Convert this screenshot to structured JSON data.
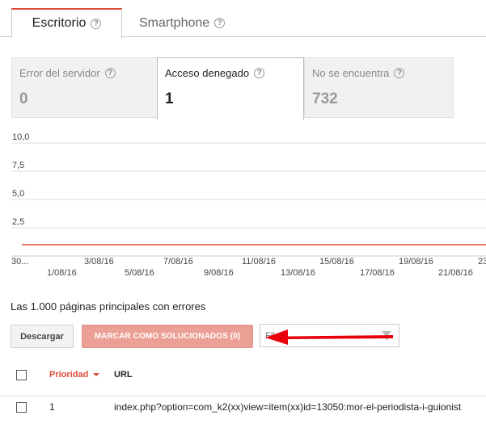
{
  "device_tabs": [
    {
      "label": "Escritorio",
      "active": true
    },
    {
      "label": "Smartphone",
      "active": false
    }
  ],
  "help_glyph": "?",
  "categories": [
    {
      "label": "Error del servidor",
      "count": "0",
      "selected": false
    },
    {
      "label": "Acceso denegado",
      "count": "1",
      "selected": true
    },
    {
      "label": "No se encuentra",
      "count": "732",
      "selected": false
    }
  ],
  "chart_data": {
    "type": "line",
    "y_ticks": [
      "10,0",
      "7,5",
      "5,0",
      "2,5"
    ],
    "ylim": [
      0,
      10
    ],
    "x_ticks_top": [
      "30...",
      "3/08/16",
      "7/08/16",
      "11/08/16",
      "15/08/16",
      "19/08/16",
      "23"
    ],
    "x_ticks_bottom": [
      "1/08/16",
      "5/08/16",
      "9/08/16",
      "13/08/16",
      "17/08/16",
      "21/08/16"
    ],
    "series": [
      {
        "color": "#dd4b39",
        "values": [
          1,
          1,
          1,
          1,
          1,
          1,
          1,
          1,
          1,
          1,
          1,
          1,
          1,
          1,
          1,
          1,
          1,
          1,
          1,
          1,
          1,
          1,
          1,
          1,
          1
        ]
      }
    ],
    "grid": true
  },
  "list": {
    "title": "Las 1.000 páginas principales con errores",
    "download_label": "Descargar",
    "mark_fixed_label": "MARCAR COMO SOLUCIONADOS (0)",
    "filter_placeholder": "Fil",
    "columns": {
      "priority": "Prioridad",
      "url": "URL"
    },
    "rows": [
      {
        "priority": "1",
        "url": "index.php?option=com_k2(xx)view=item(xx)id=13050:mor-el-periodista-i-guionist"
      }
    ]
  },
  "colors": {
    "accent": "#dd4b39",
    "mark_button": "#eb9f95",
    "annotation_arrow": "#e8000b"
  }
}
